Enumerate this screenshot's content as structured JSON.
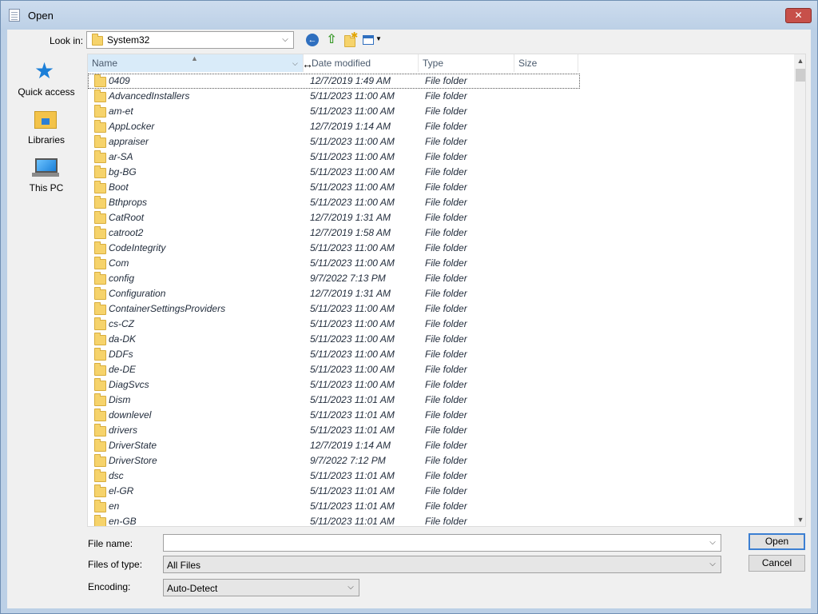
{
  "window": {
    "title": "Open",
    "close_label": "✕"
  },
  "toolbar": {
    "lookin_label": "Look in:",
    "lookin_value": "System32"
  },
  "places": [
    {
      "label": "Quick access",
      "icon": "star-icon"
    },
    {
      "label": "Libraries",
      "icon": "libraries-icon"
    },
    {
      "label": "This PC",
      "icon": "computer-icon"
    }
  ],
  "columns": {
    "name": "Name",
    "date": "Date modified",
    "type": "Type",
    "size": "Size"
  },
  "files": [
    {
      "name": "0409",
      "date": "12/7/2019 1:49 AM",
      "type": "File folder"
    },
    {
      "name": "AdvancedInstallers",
      "date": "5/11/2023 11:00 AM",
      "type": "File folder"
    },
    {
      "name": "am-et",
      "date": "5/11/2023 11:00 AM",
      "type": "File folder"
    },
    {
      "name": "AppLocker",
      "date": "12/7/2019 1:14 AM",
      "type": "File folder"
    },
    {
      "name": "appraiser",
      "date": "5/11/2023 11:00 AM",
      "type": "File folder"
    },
    {
      "name": "ar-SA",
      "date": "5/11/2023 11:00 AM",
      "type": "File folder"
    },
    {
      "name": "bg-BG",
      "date": "5/11/2023 11:00 AM",
      "type": "File folder"
    },
    {
      "name": "Boot",
      "date": "5/11/2023 11:00 AM",
      "type": "File folder"
    },
    {
      "name": "Bthprops",
      "date": "5/11/2023 11:00 AM",
      "type": "File folder"
    },
    {
      "name": "CatRoot",
      "date": "12/7/2019 1:31 AM",
      "type": "File folder"
    },
    {
      "name": "catroot2",
      "date": "12/7/2019 1:58 AM",
      "type": "File folder"
    },
    {
      "name": "CodeIntegrity",
      "date": "5/11/2023 11:00 AM",
      "type": "File folder"
    },
    {
      "name": "Com",
      "date": "5/11/2023 11:00 AM",
      "type": "File folder"
    },
    {
      "name": "config",
      "date": "9/7/2022 7:13 PM",
      "type": "File folder"
    },
    {
      "name": "Configuration",
      "date": "12/7/2019 1:31 AM",
      "type": "File folder"
    },
    {
      "name": "ContainerSettingsProviders",
      "date": "5/11/2023 11:00 AM",
      "type": "File folder"
    },
    {
      "name": "cs-CZ",
      "date": "5/11/2023 11:00 AM",
      "type": "File folder"
    },
    {
      "name": "da-DK",
      "date": "5/11/2023 11:00 AM",
      "type": "File folder"
    },
    {
      "name": "DDFs",
      "date": "5/11/2023 11:00 AM",
      "type": "File folder"
    },
    {
      "name": "de-DE",
      "date": "5/11/2023 11:00 AM",
      "type": "File folder"
    },
    {
      "name": "DiagSvcs",
      "date": "5/11/2023 11:00 AM",
      "type": "File folder"
    },
    {
      "name": "Dism",
      "date": "5/11/2023 11:01 AM",
      "type": "File folder"
    },
    {
      "name": "downlevel",
      "date": "5/11/2023 11:01 AM",
      "type": "File folder"
    },
    {
      "name": "drivers",
      "date": "5/11/2023 11:01 AM",
      "type": "File folder"
    },
    {
      "name": "DriverState",
      "date": "12/7/2019 1:14 AM",
      "type": "File folder"
    },
    {
      "name": "DriverStore",
      "date": "9/7/2022 7:12 PM",
      "type": "File folder"
    },
    {
      "name": "dsc",
      "date": "5/11/2023 11:01 AM",
      "type": "File folder"
    },
    {
      "name": "el-GR",
      "date": "5/11/2023 11:01 AM",
      "type": "File folder"
    },
    {
      "name": "en",
      "date": "5/11/2023 11:01 AM",
      "type": "File folder"
    },
    {
      "name": "en-GB",
      "date": "5/11/2023 11:01 AM",
      "type": "File folder"
    }
  ],
  "bottom": {
    "filename_label": "File name:",
    "filename_value": "",
    "filetype_label": "Files of type:",
    "filetype_value": "All Files",
    "encoding_label": "Encoding:",
    "encoding_value": "Auto-Detect",
    "open_label": "Open",
    "cancel_label": "Cancel"
  },
  "colors": {
    "accent": "#3c7fd2",
    "folder": "#f6d36b",
    "close": "#c7504a"
  }
}
